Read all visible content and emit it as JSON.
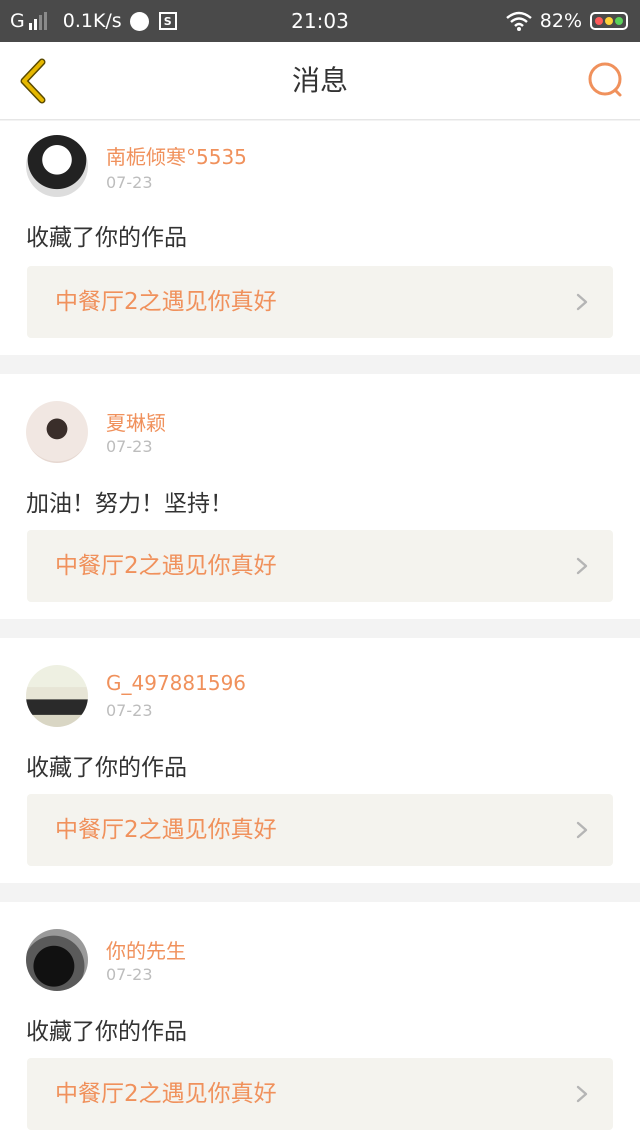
{
  "status_bar": {
    "carrier": "G",
    "net_speed": "0.1K/s",
    "time": "21:03",
    "battery": "82%"
  },
  "nav": {
    "title": "消息",
    "back_icon": "chevron-left-icon",
    "search_icon": "search-icon"
  },
  "colors": {
    "accent": "#f0915c",
    "back_icon": "#e6b800",
    "link_bg": "#f4f3ee"
  },
  "messages": [
    {
      "username": "南栀倾寒°5535",
      "date": "07-23",
      "text": "收藏了你的作品",
      "work_title": "中餐厅2之遇见你真好"
    },
    {
      "username": "夏琳颖",
      "date": "07-23",
      "text": "加油！努力！坚持！",
      "work_title": "中餐厅2之遇见你真好"
    },
    {
      "username": "G_497881596",
      "date": "07-23",
      "text": "收藏了你的作品",
      "work_title": "中餐厅2之遇见你真好"
    },
    {
      "username": "你的先生",
      "date": "07-23",
      "text": "收藏了你的作品",
      "work_title": "中餐厅2之遇见你真好"
    }
  ]
}
